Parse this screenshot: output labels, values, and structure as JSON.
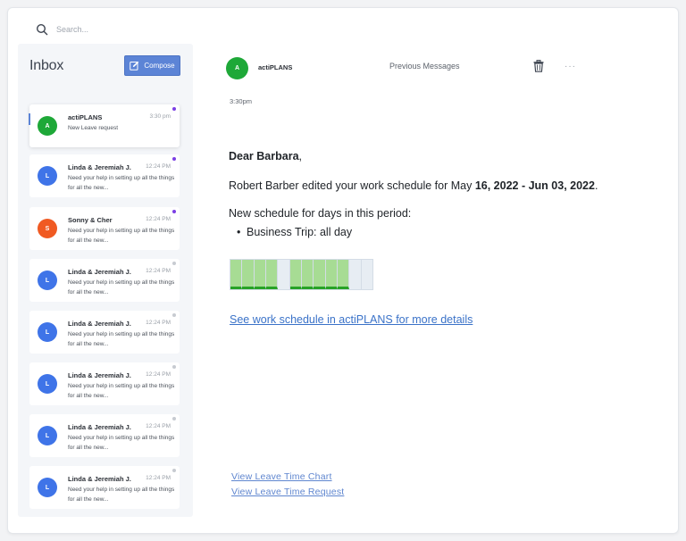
{
  "search": {
    "placeholder": "Search..."
  },
  "sidebar": {
    "title": "Inbox",
    "compose_label": "Compose",
    "messages": [
      {
        "initial": "A",
        "sender": "actiPLANS",
        "time": "3:30 pm",
        "preview": "New Leave request",
        "avatar_color": "#1ea838",
        "unread_dot": "#7b3fe4",
        "active": true
      },
      {
        "initial": "L",
        "sender": "Linda & Jeremiah J.",
        "time": "12:24 PM",
        "preview": "Need your help in setting up all the things for all the new...",
        "avatar_color": "#3f74e8",
        "unread_dot": "#7b3fe4"
      },
      {
        "initial": "S",
        "sender": "Sonny & Cher",
        "time": "12:24 PM",
        "preview": "Need your help in setting up all the things for all the new...",
        "avatar_color": "#f05a22",
        "unread_dot": "#7b3fe4"
      },
      {
        "initial": "L",
        "sender": "Linda & Jeremiah J.",
        "time": "12:24 PM",
        "preview": "Need your help in setting up all the things for all the new...",
        "avatar_color": "#3f74e8",
        "unread_dot": "#c7cbd1"
      },
      {
        "initial": "L",
        "sender": "Linda & Jeremiah J.",
        "time": "12:24 PM",
        "preview": "Need your help in setting up all the things for all the new...",
        "avatar_color": "#3f74e8",
        "unread_dot": "#c7cbd1"
      },
      {
        "initial": "L",
        "sender": "Linda & Jeremiah J.",
        "time": "12:24 PM",
        "preview": "Need your help in setting up all the things for all the new...",
        "avatar_color": "#3f74e8",
        "unread_dot": "#c7cbd1"
      },
      {
        "initial": "L",
        "sender": "Linda & Jeremiah J.",
        "time": "12:24 PM",
        "preview": "Need your help in setting up all the things for all the new...",
        "avatar_color": "#3f74e8",
        "unread_dot": "#c7cbd1"
      },
      {
        "initial": "L",
        "sender": "Linda & Jeremiah J.",
        "time": "12:24 PM",
        "preview": "Need your help in setting up all the things for all the new...",
        "avatar_color": "#3f74e8",
        "unread_dot": "#c7cbd1"
      }
    ]
  },
  "email": {
    "avatar_initial": "A",
    "sender": "actiPLANS",
    "previous_messages_label": "Previous Messages",
    "more_label": "···",
    "time": "3:30pm",
    "greeting_name": "Dear Barbara",
    "greeting_punct": ",",
    "intro_text": "Robert Barber edited your work schedule for May ",
    "intro_dates": "16, 2022 - Jun 03, 2022",
    "intro_end": ".",
    "schedule_title": "New schedule for days in this period:",
    "schedule_item": "Business Trip: all day",
    "calendar_days": [
      true,
      true,
      true,
      true,
      false,
      true,
      true,
      true,
      true,
      true,
      false,
      false
    ],
    "details_link": "See work schedule in actiPLANS for more details",
    "footer_links": [
      "View Leave Time Chart",
      "View Leave Time Request"
    ]
  },
  "colors": {
    "accent": "#5c84d6",
    "link": "#3a72c8",
    "calendar_on": "#a7dc94",
    "calendar_on_border": "#27a227",
    "calendar_off": "#e7edf3"
  },
  "icons": {
    "search": "search-icon",
    "compose": "edit-icon",
    "trash": "trash-icon",
    "more": "more-horizontal-icon"
  }
}
